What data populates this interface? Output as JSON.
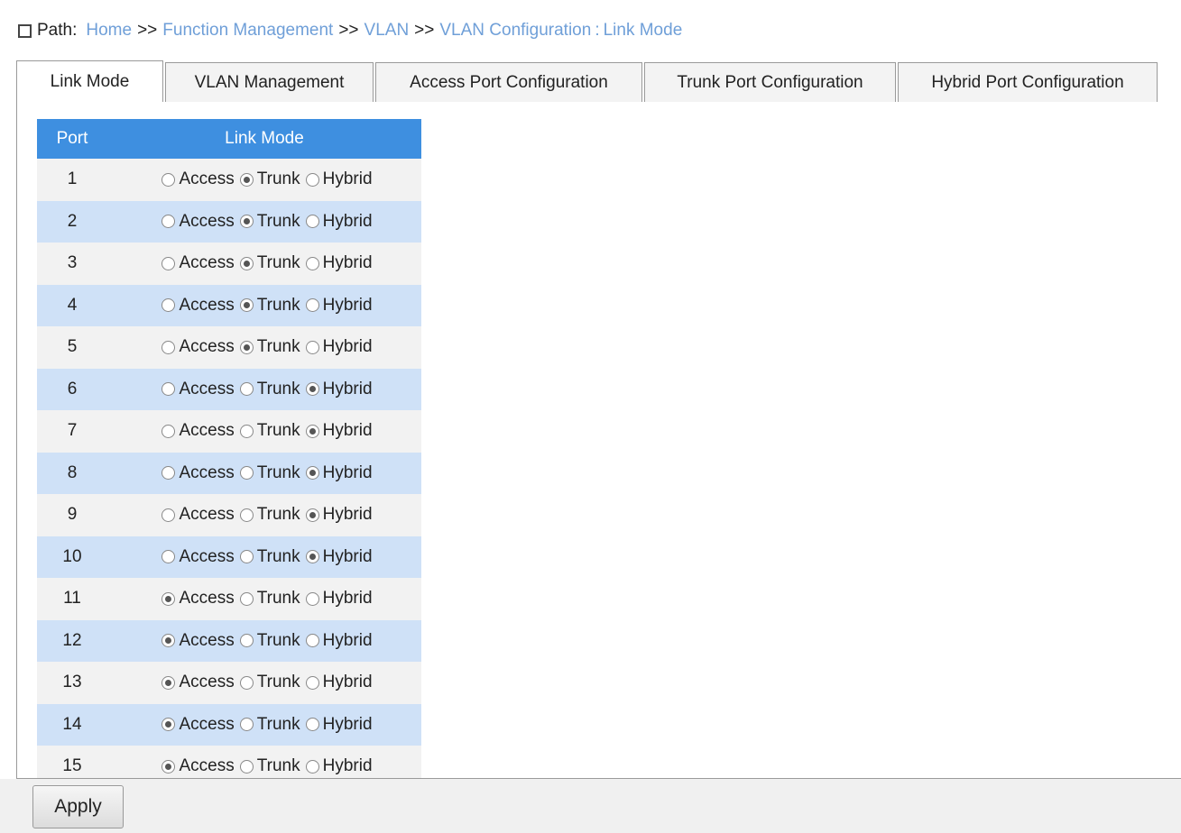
{
  "breadcrumb": {
    "label": "Path:",
    "items": [
      "Home",
      "Function Management",
      "VLAN",
      "VLAN Configuration"
    ],
    "separator": ">>",
    "current": "Link Mode",
    "current_separator": ":"
  },
  "tabs": [
    {
      "label": "Link Mode",
      "active": true
    },
    {
      "label": "VLAN Management",
      "active": false
    },
    {
      "label": "Access Port Configuration",
      "active": false
    },
    {
      "label": "Trunk Port Configuration",
      "active": false
    },
    {
      "label": "Hybrid Port Configuration",
      "active": false
    }
  ],
  "table": {
    "headers": {
      "port": "Port",
      "mode": "Link Mode"
    },
    "options": [
      "Access",
      "Trunk",
      "Hybrid"
    ],
    "rows": [
      {
        "port": "1",
        "mode": "Trunk"
      },
      {
        "port": "2",
        "mode": "Trunk"
      },
      {
        "port": "3",
        "mode": "Trunk"
      },
      {
        "port": "4",
        "mode": "Trunk"
      },
      {
        "port": "5",
        "mode": "Trunk"
      },
      {
        "port": "6",
        "mode": "Hybrid"
      },
      {
        "port": "7",
        "mode": "Hybrid"
      },
      {
        "port": "8",
        "mode": "Hybrid"
      },
      {
        "port": "9",
        "mode": "Hybrid"
      },
      {
        "port": "10",
        "mode": "Hybrid"
      },
      {
        "port": "11",
        "mode": "Access"
      },
      {
        "port": "12",
        "mode": "Access"
      },
      {
        "port": "13",
        "mode": "Access"
      },
      {
        "port": "14",
        "mode": "Access"
      },
      {
        "port": "15",
        "mode": "Access"
      }
    ]
  },
  "footer": {
    "apply_label": "Apply"
  },
  "colors": {
    "header_blue": "#3e8fe0",
    "row_alt_blue": "#cfe1f7",
    "row_gray": "#f2f2f2",
    "link_blue": "#6f9fd8"
  },
  "icons": {
    "breadcrumb_marker": "square-icon"
  }
}
